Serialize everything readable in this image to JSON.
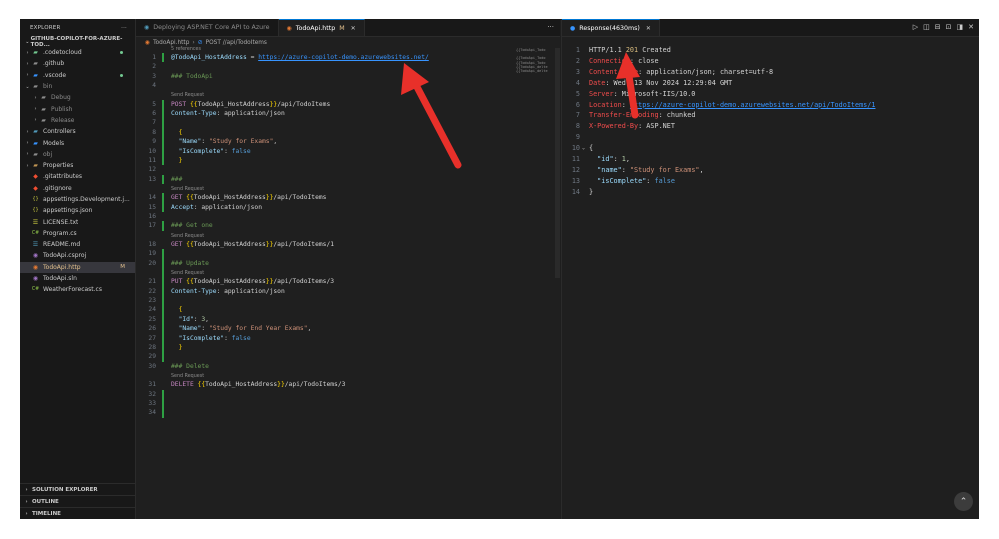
{
  "explorer": {
    "title": "EXPLORER",
    "more": "···",
    "project": "GITHUB-COPILOT-FOR-AZURE-TOD...",
    "tree": [
      {
        "name": ".codetocloud",
        "chevron": "›",
        "icon": "▰",
        "icon_color": "#73c991",
        "indent": 0,
        "dot": true
      },
      {
        "name": ".github",
        "chevron": "›",
        "icon": "▰",
        "icon_color": "#8c8c8c",
        "indent": 0
      },
      {
        "name": ".vscode",
        "chevron": "›",
        "icon": "▰",
        "icon_color": "#3794ff",
        "indent": 0,
        "dot": true
      },
      {
        "name": "bin",
        "chevron": "⌄",
        "icon": "▰",
        "icon_color": "#8c8c8c",
        "indent": 0,
        "ignored": true
      },
      {
        "name": "Debug",
        "chevron": "›",
        "icon": "▰",
        "icon_color": "#8c8c8c",
        "indent": 1,
        "ignored": true
      },
      {
        "name": "Publish",
        "chevron": "›",
        "icon": "▰",
        "icon_color": "#8c8c8c",
        "indent": 1,
        "ignored": true
      },
      {
        "name": "Release",
        "chevron": "›",
        "icon": "▰",
        "icon_color": "#8c8c8c",
        "indent": 1,
        "ignored": true
      },
      {
        "name": "Controllers",
        "chevron": "›",
        "icon": "▰",
        "icon_color": "#519aba",
        "indent": 0
      },
      {
        "name": "Models",
        "chevron": "›",
        "icon": "▰",
        "icon_color": "#3794ff",
        "indent": 0
      },
      {
        "name": "obj",
        "chevron": "›",
        "icon": "▰",
        "icon_color": "#8c8c8c",
        "indent": 0,
        "ignored": true
      },
      {
        "name": "Properties",
        "chevron": "›",
        "icon": "▰",
        "icon_color": "#c09553",
        "indent": 0
      },
      {
        "name": ".gitattributes",
        "chevron": "",
        "icon": "◆",
        "icon_color": "#f14e32",
        "indent": 0
      },
      {
        "name": ".gitignore",
        "chevron": "",
        "icon": "◆",
        "icon_color": "#f14e32",
        "indent": 0
      },
      {
        "name": "appsettings.Development.j...",
        "chevron": "",
        "icon": "{}",
        "icon_color": "#cbcb41",
        "indent": 0
      },
      {
        "name": "appsettings.json",
        "chevron": "",
        "icon": "{}",
        "icon_color": "#cbcb41",
        "indent": 0
      },
      {
        "name": "LICENSE.txt",
        "chevron": "",
        "icon": "☰",
        "icon_color": "#cbcb41",
        "indent": 0
      },
      {
        "name": "Program.cs",
        "chevron": "",
        "icon": "C#",
        "icon_color": "#8dc149",
        "indent": 0
      },
      {
        "name": "README.md",
        "chevron": "",
        "icon": "☰",
        "icon_color": "#519aba",
        "indent": 0
      },
      {
        "name": "TodoApi.csproj",
        "chevron": "",
        "icon": "◉",
        "icon_color": "#a074c4",
        "indent": 0
      },
      {
        "name": "TodoApi.http",
        "chevron": "",
        "icon": "◉",
        "icon_color": "#e37933",
        "indent": 0,
        "active": true,
        "badge": "M"
      },
      {
        "name": "TodoApi.sln",
        "chevron": "",
        "icon": "◉",
        "icon_color": "#a074c4",
        "indent": 0
      },
      {
        "name": "WeatherForecast.cs",
        "chevron": "",
        "icon": "C#",
        "icon_color": "#8dc149",
        "indent": 0
      }
    ],
    "sections": [
      {
        "label": "SOLUTION EXPLORER",
        "chevron": "›"
      },
      {
        "label": "OUTLINE",
        "chevron": "›"
      },
      {
        "label": "TIMELINE",
        "chevron": "›"
      }
    ]
  },
  "editor": {
    "tabs": [
      {
        "label": "Deploying ASP.NET Core API to Azure",
        "icon": "◉",
        "active": false
      },
      {
        "label": "TodoApi.http",
        "icon": "◉",
        "active": true,
        "modified": "M",
        "close": "✕"
      }
    ],
    "more": "···",
    "breadcrumb": {
      "file": "TodoApi.http",
      "separator": "›",
      "section": "POST //api/TodoItems"
    },
    "references": "5 references",
    "send_request": "Send Request",
    "lines": [
      {
        "n": 1,
        "y": 0,
        "segs": [
          [
            "@TodoApi_HostAddress",
            "k-var"
          ],
          [
            " = ",
            "k-plain"
          ],
          [
            "https://azure-copilot-demo.azurewebsites.net/",
            "k-url"
          ]
        ]
      },
      {
        "n": 2,
        "y": 1,
        "segs": []
      },
      {
        "n": 3,
        "y": 2,
        "segs": [
          [
            "### TodoApi",
            "k-com"
          ]
        ]
      },
      {
        "n": 4,
        "y": 3,
        "segs": []
      },
      {
        "n": 5,
        "y": 5,
        "segs": [
          [
            "POST ",
            "k-meth"
          ],
          [
            "{{",
            "k-brace"
          ],
          [
            "TodoApi_HostAddress",
            "k-plain"
          ],
          [
            "}}",
            "k-brace"
          ],
          [
            "/api/TodoItems",
            "k-plain"
          ]
        ],
        "send": true
      },
      {
        "n": 6,
        "y": 6,
        "segs": [
          [
            "Content-Type",
            "k-var"
          ],
          [
            ": application/json",
            "k-plain"
          ]
        ]
      },
      {
        "n": 7,
        "y": 7,
        "segs": []
      },
      {
        "n": 8,
        "y": 8,
        "segs": [
          [
            "  {",
            "k-brace"
          ]
        ]
      },
      {
        "n": 9,
        "y": 9,
        "segs": [
          [
            "  \"Name\"",
            "k-key"
          ],
          [
            ": ",
            "k-plain"
          ],
          [
            "\"Study for Exams\"",
            "k-str"
          ],
          [
            ",",
            "k-plain"
          ]
        ]
      },
      {
        "n": 10,
        "y": 10,
        "segs": [
          [
            "  \"IsComplete\"",
            "k-key"
          ],
          [
            ": ",
            "k-plain"
          ],
          [
            "false",
            "k-bool"
          ]
        ]
      },
      {
        "n": 11,
        "y": 11,
        "segs": [
          [
            "  }",
            "k-brace"
          ]
        ]
      },
      {
        "n": 12,
        "y": 12,
        "segs": []
      },
      {
        "n": 13,
        "y": 13,
        "segs": [
          [
            "###",
            "k-com"
          ]
        ]
      },
      {
        "n": 14,
        "y": 15,
        "segs": [
          [
            "GET ",
            "k-meth"
          ],
          [
            "{{",
            "k-brace"
          ],
          [
            "TodoApi_HostAddress",
            "k-plain"
          ],
          [
            "}}",
            "k-brace"
          ],
          [
            "/api/TodoItems",
            "k-plain"
          ]
        ],
        "send": true
      },
      {
        "n": 15,
        "y": 16,
        "segs": [
          [
            "Accept",
            "k-var"
          ],
          [
            ": application/json",
            "k-plain"
          ]
        ]
      },
      {
        "n": 16,
        "y": 17,
        "segs": []
      },
      {
        "n": 17,
        "y": 18,
        "segs": [
          [
            "### Get one",
            "k-com"
          ]
        ]
      },
      {
        "n": 18,
        "y": 20,
        "segs": [
          [
            "GET ",
            "k-meth"
          ],
          [
            "{{",
            "k-brace"
          ],
          [
            "TodoApi_HostAddress",
            "k-plain"
          ],
          [
            "}}",
            "k-brace"
          ],
          [
            "/api/TodoItems/1",
            "k-plain"
          ]
        ],
        "send": true
      },
      {
        "n": 19,
        "y": 21,
        "segs": []
      },
      {
        "n": 20,
        "y": 22,
        "segs": [
          [
            "### Update",
            "k-com"
          ]
        ]
      },
      {
        "n": 21,
        "y": 24,
        "segs": [
          [
            "PUT ",
            "k-meth"
          ],
          [
            "{{",
            "k-brace"
          ],
          [
            "TodoApi_HostAddress",
            "k-plain"
          ],
          [
            "}}",
            "k-brace"
          ],
          [
            "/api/TodoItems/3",
            "k-plain"
          ]
        ],
        "send": true
      },
      {
        "n": 22,
        "y": 25,
        "segs": [
          [
            "Content-Type",
            "k-var"
          ],
          [
            ": application/json",
            "k-plain"
          ]
        ]
      },
      {
        "n": 23,
        "y": 26,
        "segs": []
      },
      {
        "n": 24,
        "y": 27,
        "segs": [
          [
            "  {",
            "k-brace"
          ]
        ]
      },
      {
        "n": 25,
        "y": 28,
        "segs": [
          [
            "  \"Id\"",
            "k-key"
          ],
          [
            ": ",
            "k-plain"
          ],
          [
            "3",
            "k-num"
          ],
          [
            ",",
            "k-plain"
          ]
        ]
      },
      {
        "n": 26,
        "y": 29,
        "segs": [
          [
            "  \"Name\"",
            "k-key"
          ],
          [
            ": ",
            "k-plain"
          ],
          [
            "\"Study for End Year Exams\"",
            "k-str"
          ],
          [
            ",",
            "k-plain"
          ]
        ]
      },
      {
        "n": 27,
        "y": 30,
        "segs": [
          [
            "  \"IsComplete\"",
            "k-key"
          ],
          [
            ": ",
            "k-plain"
          ],
          [
            "false",
            "k-bool"
          ]
        ]
      },
      {
        "n": 28,
        "y": 31,
        "segs": [
          [
            "  }",
            "k-brace"
          ]
        ]
      },
      {
        "n": 29,
        "y": 32,
        "segs": []
      },
      {
        "n": 30,
        "y": 33,
        "segs": [
          [
            "### Delete",
            "k-com"
          ]
        ]
      },
      {
        "n": 31,
        "y": 35,
        "segs": [
          [
            "DELETE ",
            "k-meth"
          ],
          [
            "{{",
            "k-brace"
          ],
          [
            "TodoApi_HostAddress",
            "k-plain"
          ],
          [
            "}}",
            "k-brace"
          ],
          [
            "/api/TodoItems/3",
            "k-plain"
          ]
        ],
        "send": true
      },
      {
        "n": 32,
        "y": 36,
        "segs": []
      },
      {
        "n": 33,
        "y": 37,
        "segs": []
      },
      {
        "n": 34,
        "y": 38,
        "segs": []
      }
    ],
    "minimap": [
      "{{TodoApi_Todo",
      "",
      "{{TodoApi_Todo",
      "{{TodoApi_Todo",
      "{{TodoApi_delte",
      "{{TodoApi_delte"
    ]
  },
  "response": {
    "tab_label": "Response(4630ms)",
    "tab_close": "✕",
    "actions": [
      "▷",
      "◫",
      "⊟",
      "⊡",
      "◨",
      "✕"
    ],
    "lines": [
      {
        "n": 1,
        "segs": [
          [
            "HTTP/1.1 ",
            "k-plain"
          ],
          [
            "201",
            "k-status"
          ],
          [
            " Created",
            "k-plain"
          ]
        ]
      },
      {
        "n": 2,
        "segs": [
          [
            "Connection",
            "k-hdr"
          ],
          [
            ": close",
            "k-plain"
          ]
        ]
      },
      {
        "n": 3,
        "segs": [
          [
            "Content-Type",
            "k-hdr"
          ],
          [
            ": application/json; charset=utf-8",
            "k-plain"
          ]
        ]
      },
      {
        "n": 4,
        "segs": [
          [
            "Date",
            "k-hdr"
          ],
          [
            ": Wed, 13 Nov 2024 12:29:04 GMT",
            "k-plain"
          ]
        ]
      },
      {
        "n": 5,
        "segs": [
          [
            "Server",
            "k-hdr"
          ],
          [
            ": Microsoft-IIS/10.0",
            "k-plain"
          ]
        ]
      },
      {
        "n": 6,
        "segs": [
          [
            "Location",
            "k-hdr"
          ],
          [
            ": ",
            "k-plain"
          ],
          [
            "https://azure-copilot-demo.azurewebsites.net/api/TodoItems/1",
            "k-url"
          ]
        ]
      },
      {
        "n": 7,
        "segs": [
          [
            "Transfer-Encoding",
            "k-hdr"
          ],
          [
            ": chunked",
            "k-plain"
          ]
        ]
      },
      {
        "n": 8,
        "segs": [
          [
            "X-Powered-By",
            "k-hdr"
          ],
          [
            ": ASP.NET",
            "k-plain"
          ]
        ]
      },
      {
        "n": 9,
        "segs": []
      },
      {
        "n": 10,
        "segs": [
          [
            "{",
            "k-plain"
          ]
        ],
        "fold": "⌄"
      },
      {
        "n": 11,
        "segs": [
          [
            "  \"id\"",
            "k-key"
          ],
          [
            ": ",
            "k-plain"
          ],
          [
            "1",
            "k-num"
          ],
          [
            ",",
            "k-plain"
          ]
        ]
      },
      {
        "n": 12,
        "segs": [
          [
            "  \"name\"",
            "k-key"
          ],
          [
            ": ",
            "k-plain"
          ],
          [
            "\"Study for Exams\"",
            "k-str"
          ],
          [
            ",",
            "k-plain"
          ]
        ]
      },
      {
        "n": 13,
        "segs": [
          [
            "  \"isComplete\"",
            "k-key"
          ],
          [
            ": ",
            "k-plain"
          ],
          [
            "false",
            "k-bool"
          ]
        ]
      },
      {
        "n": 14,
        "segs": [
          [
            "}",
            "k-plain"
          ]
        ]
      }
    ],
    "scroll_top_icon": "⌃"
  },
  "colors": {
    "arrow": "#e8302a",
    "accent": "#0078d4",
    "background": "#1e1e1e"
  }
}
